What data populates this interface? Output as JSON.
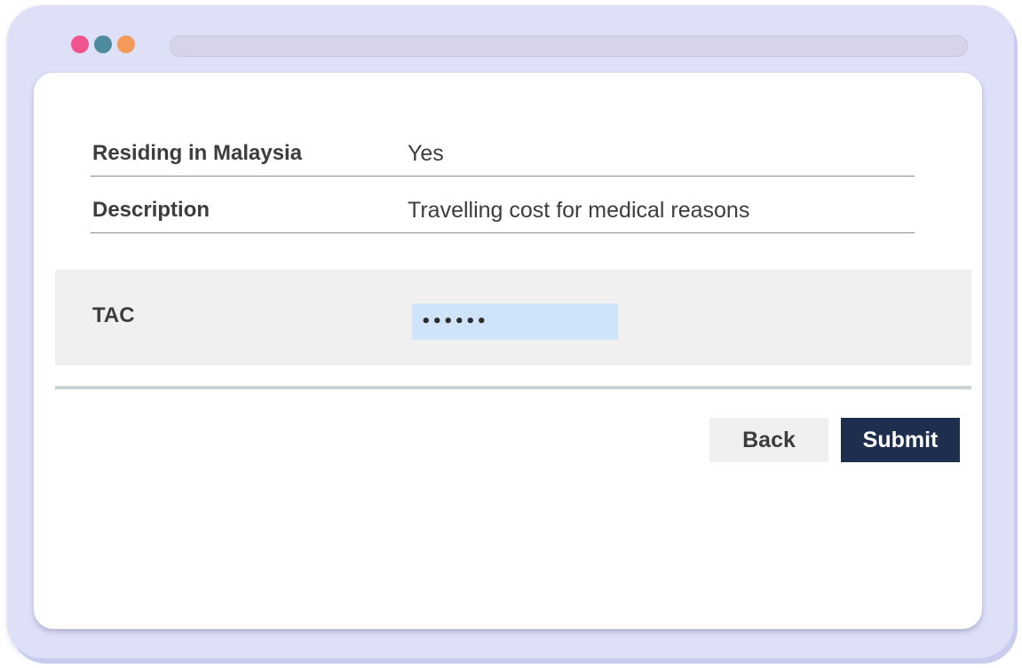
{
  "window": {
    "traffic_lights": [
      {
        "name": "close",
        "color": "#f0548f"
      },
      {
        "name": "minimize",
        "color": "#4d8c9e"
      },
      {
        "name": "maximize",
        "color": "#f49a5a"
      }
    ],
    "frame_color": "#dde0f7"
  },
  "details": {
    "residing_label": "Residing in Malaysia",
    "residing_value": "Yes",
    "description_label": "Description",
    "description_value": "Travelling cost for medical reasons"
  },
  "tac": {
    "label": "TAC",
    "value": "••••••",
    "input_bg": "#cfe4f9"
  },
  "actions": {
    "back_label": "Back",
    "submit_label": "Submit",
    "submit_color": "#1d2e4f"
  }
}
